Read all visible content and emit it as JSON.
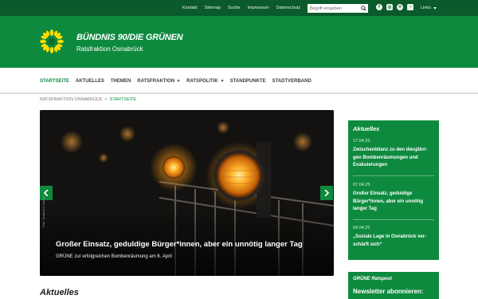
{
  "topbar": {
    "links": [
      "Kontakt",
      "Sitemap",
      "Suche",
      "Impressum",
      "Datenschutz"
    ],
    "search_placeholder": "Begriff eingeben",
    "socials": [
      "facebook-icon",
      "instagram-icon",
      "twitter-x-icon",
      "rss-icon"
    ],
    "links_menu": "Links"
  },
  "header": {
    "title": "BÜNDNIS 90/DIE GRÜNEN",
    "subtitle": "Ratsfraktion Osnabrück"
  },
  "nav": {
    "items": [
      {
        "label": "STARTSEITE",
        "active": true,
        "dropdown": false
      },
      {
        "label": "AKTUELLES",
        "active": false,
        "dropdown": false
      },
      {
        "label": "THEMEN",
        "active": false,
        "dropdown": false
      },
      {
        "label": "RATSFRAKTION",
        "active": false,
        "dropdown": true
      },
      {
        "label": "RATSPOLITIK",
        "active": false,
        "dropdown": true
      },
      {
        "label": "STANDPUNKTE",
        "active": false,
        "dropdown": false
      },
      {
        "label": "STADTVERBAND",
        "active": false,
        "dropdown": false
      }
    ]
  },
  "breadcrumb": {
    "parent": "RATSFRAKTION OSNABRÜCK",
    "separator": ">",
    "current": "STARTSEITE"
  },
  "hero": {
    "title": "Großer Einsatz, geduldige Bürger*innen, aber ein unnötig langer Tag",
    "subtitle": "GRÜNE zur erfolgreichen Bombenräumung am 6. April",
    "credit": "Foto: Jonathan | Unsplash"
  },
  "main": {
    "section_title": "Aktuelles"
  },
  "sidebar": {
    "title": "Aktuelles",
    "news": [
      {
        "date": "17.04.25",
        "lines": [
          "Zwischenbilanz zu den diesjähri-",
          "gen Bombenräumungen und",
          "Evakuierungen"
        ]
      },
      {
        "date": "07.04.25",
        "lines": [
          "Großer Einsatz, geduldige",
          "Bürger*innen, aber ein unnötig",
          "langer Tag"
        ]
      },
      {
        "date": "04.04.25",
        "lines": [
          "„Soziale Lage in Osnabrück ver-",
          "schärft sich“"
        ]
      }
    ],
    "newsletter_kicker": "GRÜNE Ratspost",
    "newsletter_title": "Newsletter abonnieren:"
  },
  "colors": {
    "dark_green": "#0b5a2b",
    "brand_green": "#0e8a3e",
    "sun_yellow": "#ffdd00"
  }
}
